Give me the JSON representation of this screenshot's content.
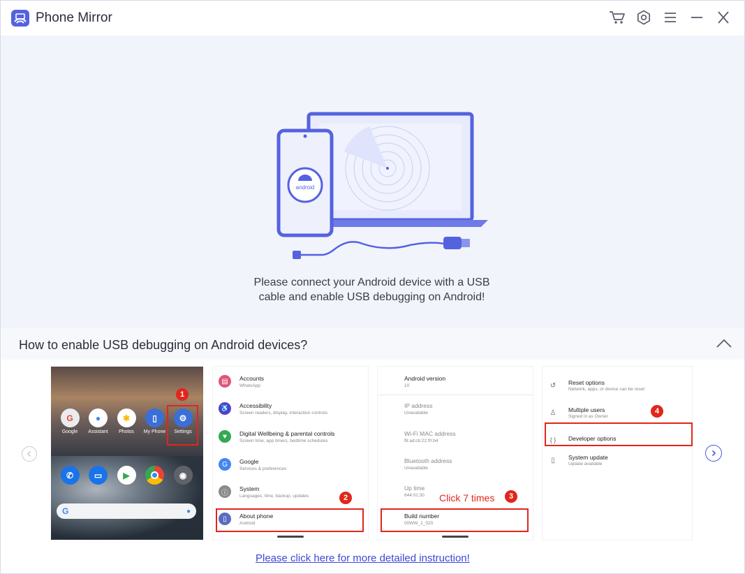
{
  "app": {
    "title": "Phone Mirror",
    "accent_color": "#5562e0",
    "icons": [
      "cart-icon",
      "settings-icon",
      "menu-icon",
      "minimize-icon",
      "close-icon"
    ]
  },
  "hero": {
    "line1": "Please connect your Android device with a USB",
    "line2": "cable and enable USB debugging on Android!",
    "phone_label": "android"
  },
  "guide": {
    "title": "How to enable USB debugging on Android devices?",
    "link_text": "Please click here for more detailed instruction!",
    "click_note": "Click 7 times",
    "steps": [
      "1",
      "2",
      "3",
      "4"
    ],
    "home_apps_row1": [
      {
        "label": "Google",
        "icon": "google-folder-icon"
      },
      {
        "label": "Assistant",
        "icon": "assistant-icon"
      },
      {
        "label": "Photos",
        "icon": "photos-icon"
      },
      {
        "label": "My Phone",
        "icon": "my-phone-icon"
      },
      {
        "label": "Settings",
        "icon": "gear-icon"
      }
    ],
    "home_apps_row2": [
      {
        "icon": "phone-call-icon"
      },
      {
        "icon": "messages-icon"
      },
      {
        "icon": "play-store-icon"
      },
      {
        "icon": "chrome-icon"
      },
      {
        "icon": "camera-icon"
      }
    ],
    "settings_list": [
      {
        "title": "Accounts",
        "sub": "WhatsApp",
        "color": "#e0557a"
      },
      {
        "title": "Accessibility",
        "sub": "Screen readers, display, interaction controls",
        "color": "#5b3dc9"
      },
      {
        "title": "Digital Wellbeing & parental controls",
        "sub": "Screen time, app timers, bedtime schedules",
        "color": "#34a853"
      },
      {
        "title": "Google",
        "sub": "Services & preferences",
        "color": "#4285f4"
      },
      {
        "title": "System",
        "sub": "Languages, time, backup, updates",
        "color": "#8a8a8a"
      },
      {
        "title": "About phone",
        "sub": "Android",
        "color": "#5c6bc0"
      }
    ],
    "about_list": [
      {
        "title": "Android version",
        "sub": "10"
      },
      {
        "title": "IP address",
        "sub": "Unavailable"
      },
      {
        "title": "Wi-Fi MAC address",
        "sub": "f8:ad:cb:22:f0:b4"
      },
      {
        "title": "Bluetooth address",
        "sub": "Unavailable"
      },
      {
        "title": "Up time",
        "sub": "644:01:30"
      },
      {
        "title": "Build number",
        "sub": "00WW_1_020"
      }
    ],
    "system_list": [
      {
        "title": "Reset options",
        "sub": "Network, apps, or device can be reset",
        "icon": "reset-icon"
      },
      {
        "title": "Multiple users",
        "sub": "Signed in as Owner",
        "icon": "user-icon"
      },
      {
        "title": "Developer options",
        "sub": "",
        "icon": "code-braces-icon"
      },
      {
        "title": "System update",
        "sub": "Update available",
        "icon": "system-update-icon"
      }
    ]
  }
}
